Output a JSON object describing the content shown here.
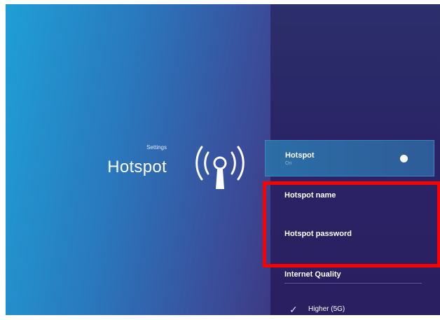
{
  "header": {
    "breadcrumb": "Settings",
    "title": "Hotspot"
  },
  "hero_icon": "hotspot-antenna-icon",
  "menu": {
    "hotspot": {
      "label": "Hotspot",
      "sub": "On",
      "toggle_on": true
    },
    "hotspot_name": {
      "label": "Hotspot name",
      "sub": ""
    },
    "hotspot_password": {
      "label": "Hotspot password",
      "sub": ""
    },
    "internet_quality": {
      "label": "Internet Quality"
    },
    "option_higher": {
      "label": "Higher (5G)",
      "selected": true
    }
  },
  "annotation": {
    "color": "#ff0000"
  },
  "colors": {
    "accent": "#2c6ea6",
    "panel": "#2a2466"
  }
}
